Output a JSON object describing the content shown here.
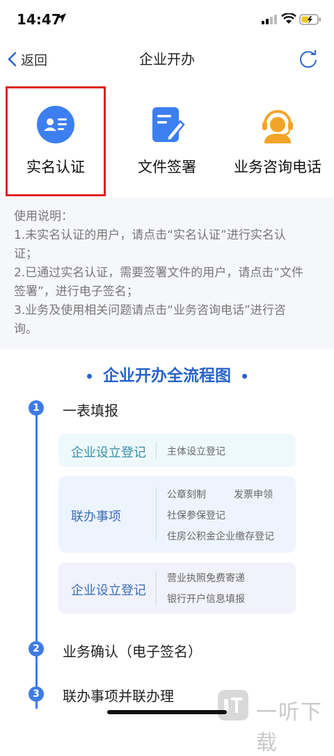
{
  "status_bar": {
    "time": "14:47"
  },
  "nav": {
    "back_label": "返回",
    "title": "企业开办"
  },
  "tiles": [
    {
      "label": "实名认证",
      "icon": "id-card-icon",
      "color": "#3d7ff0"
    },
    {
      "label": "文件签署",
      "icon": "file-sign-icon",
      "color": "#3d7ff0"
    },
    {
      "label": "业务咨询电话",
      "icon": "customer-service-icon",
      "color": "#f3a428"
    }
  ],
  "usage": {
    "lines": [
      "使用说明：",
      "1.未实名认证的用户，请点击“实名认证”进行实名认",
      "证；",
      "2.已通过实名认证，需要签署文件的用户，请点击“文件",
      "签署”，进行电子签名；",
      "3.业务及使用相关问题请点击“业务咨询电话”进行咨",
      "询。"
    ]
  },
  "flow": {
    "title": "企业开办全流程图",
    "steps": [
      {
        "num": "1",
        "label": "一表填报"
      },
      {
        "num": "2",
        "label": "业务确认（电子签名）"
      },
      {
        "num": "3",
        "label": "联办事项并联办理"
      }
    ],
    "cards": [
      {
        "name": "企业设立登记",
        "items": [
          "主体设立登记"
        ]
      },
      {
        "name": "联办事项",
        "items": [
          "公章刻制",
          "发票申领",
          "社保参保登记",
          "住房公积金企业缴存登记"
        ]
      },
      {
        "name": "企业设立登记",
        "items": [
          "营业执照免费寄递",
          "银行开户信息填报"
        ]
      }
    ]
  },
  "watermark": {
    "text": "一听下载"
  },
  "colors": {
    "accent": "#2a63c9",
    "highlight_border": "#e02020",
    "timeline": "#3f7be6"
  }
}
